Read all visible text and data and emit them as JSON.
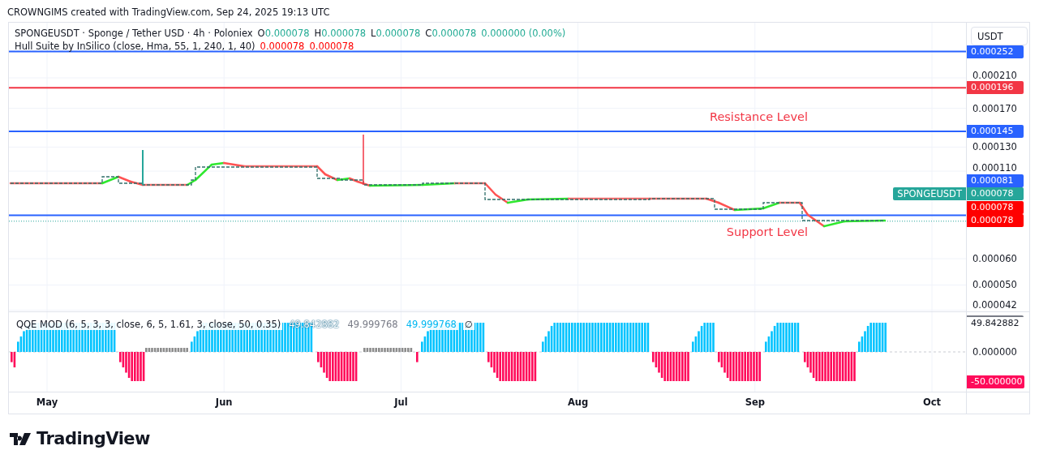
{
  "header": {
    "text": "CROWNGIMS created with TradingView.com, Sep 24, 2025 19:13 UTC"
  },
  "legend": {
    "symbol": "SPONGEUSDT · Sponge / Tether USD · 4h · Poloniex",
    "ohlc": [
      {
        "label": "O",
        "value": "0.000078"
      },
      {
        "label": "H",
        "value": "0.000078"
      },
      {
        "label": "L",
        "value": "0.000078"
      },
      {
        "label": "C",
        "value": "0.000078"
      }
    ],
    "change": "0.000000 (0.00%)"
  },
  "hull_legend": {
    "name": "Hull Suite by InSilico (close, Hma, 55, 1, 240, 1, 40)",
    "values": [
      "0.000078",
      "0.000078"
    ]
  },
  "currency_button": "USDT",
  "price_axis": {
    "ticks": [
      "0.000210",
      "0.000170",
      "0.000130",
      "0.000110",
      "0.000060",
      "0.000050",
      "0.000042"
    ]
  },
  "levels": [
    {
      "price": "0.000252",
      "color": "#2962ff"
    },
    {
      "price": "0.000196",
      "color": "#f23645"
    },
    {
      "price": "0.000145",
      "color": "#2962ff",
      "label": "Resistance Level"
    },
    {
      "price": "0.000081",
      "color": "#2962ff",
      "label": "Support Level"
    }
  ],
  "hull_tags": [
    {
      "price": "0.000078",
      "color": "#ff0000"
    },
    {
      "price": "0.000078",
      "color": "#ff0000"
    }
  ],
  "last_price": {
    "symbol": "SPONGEUSDT",
    "price": "0.000078",
    "color": "#26a69a"
  },
  "oscillator": {
    "name": "QQE MOD (6, 5, 3, 3, close, 6, 5, 1.61, 3, close, 50, 0.35)",
    "values": [
      {
        "text": "49.842882",
        "color": "#ffffff"
      },
      {
        "text": "49.999768",
        "color": "#787b86"
      },
      {
        "text": "49.999768",
        "color": "#00b7f1"
      }
    ],
    "symbol": "∅",
    "axis_ticks": [
      "0.000000"
    ],
    "tags": [
      {
        "value": "49.842882",
        "kind": "plain"
      },
      {
        "value": "-50.000000",
        "kind": "filled",
        "color": "#ff0a5a"
      }
    ]
  },
  "months": [
    "May",
    "Jun",
    "Jul",
    "Aug",
    "Sep",
    "Oct"
  ],
  "brand": "TradingView"
}
